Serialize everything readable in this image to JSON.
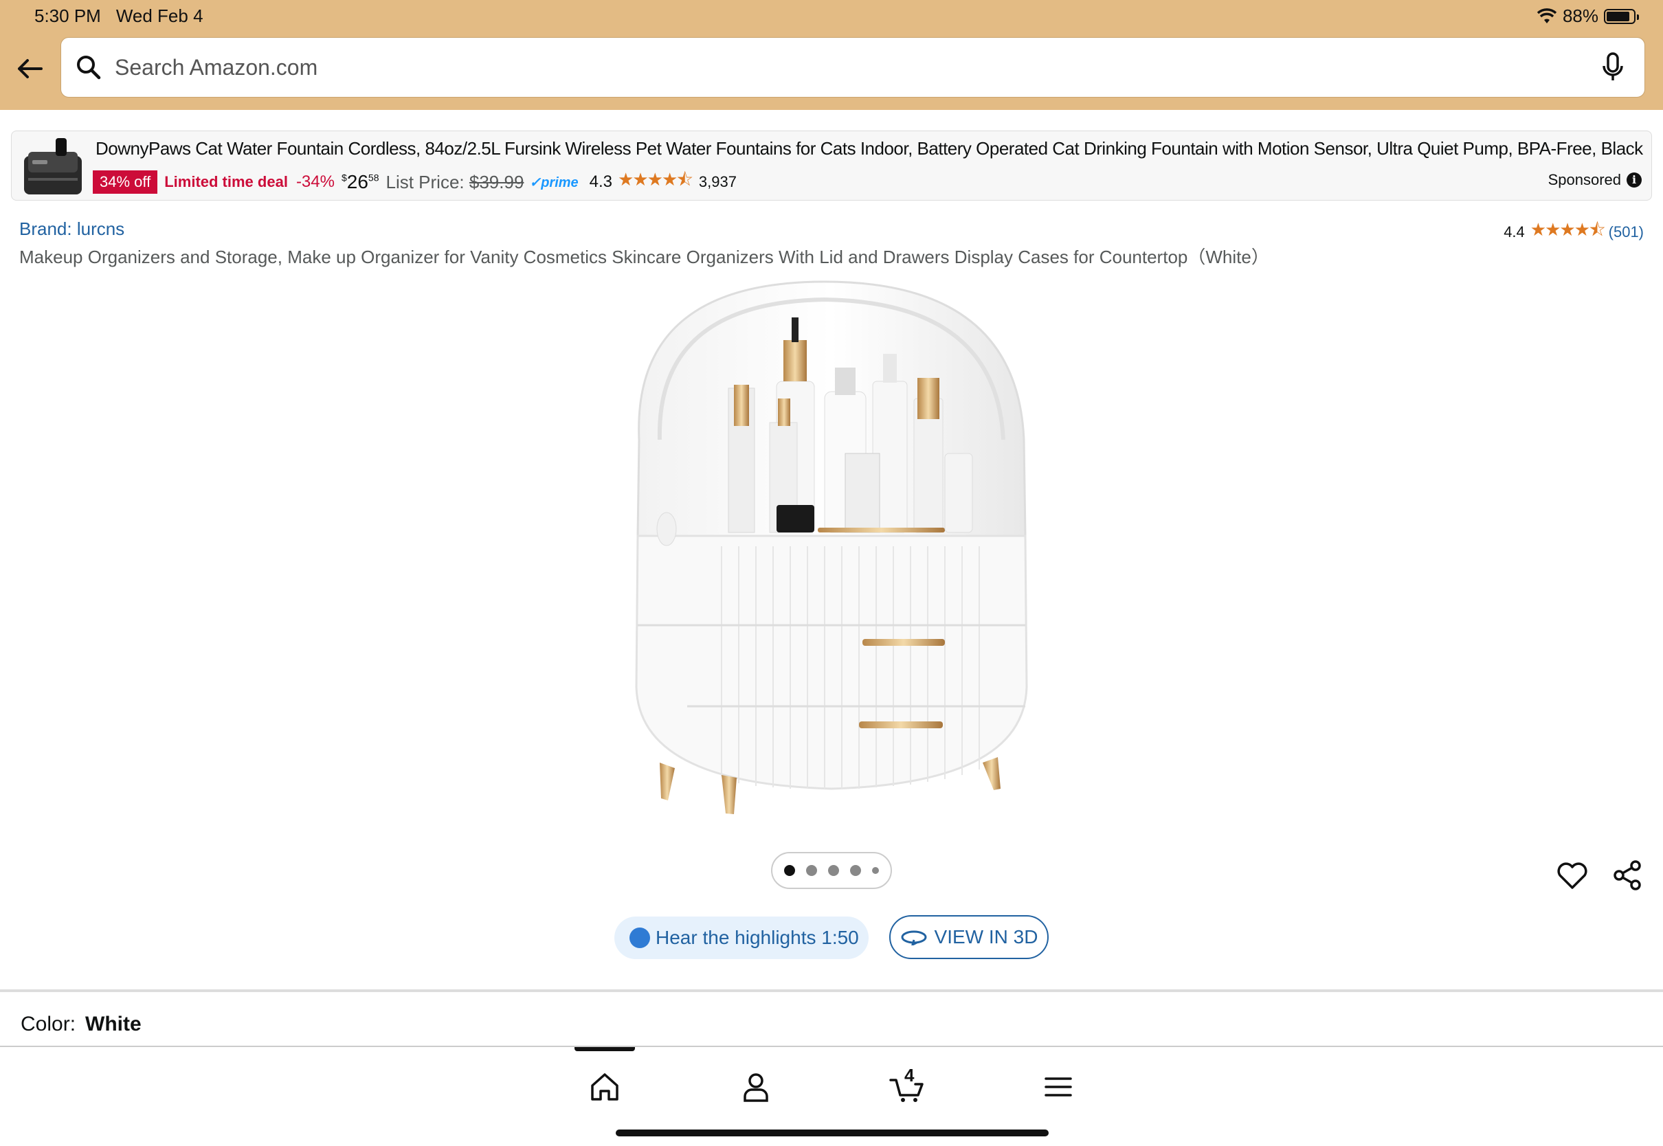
{
  "status": {
    "time": "5:30 PM",
    "date": "Wed Feb 4",
    "battery": "88%"
  },
  "search": {
    "placeholder": "Search Amazon.com"
  },
  "ad": {
    "title": "DownyPaws Cat Water Fountain Cordless, 84oz/2.5L Fursink Wireless Pet Water Fountains for Cats Indoor, Battery Operated Cat Drinking Fountain with Motion Sensor, Ultra Quiet Pump, BPA-Free, Black",
    "badge": "34% off",
    "deal": "Limited time deal",
    "discount": "-34%",
    "price_symbol": "$",
    "price_whole": "26",
    "price_fraction": "58",
    "list_label": "List Price:",
    "list_price": "$39.99",
    "prime": "prime",
    "rating": "4.3",
    "stars": "★★★★⯪",
    "review_count": "3,937",
    "sponsored": "Sponsored"
  },
  "product": {
    "brand": "Brand: lurcns",
    "rating": "4.4",
    "stars": "★★★★⯪",
    "review_count": "(501)",
    "title": "Makeup Organizers and Storage, Make up Organizer for Vanity Cosmetics Skincare Organizers With Lid and Drawers Display Cases for Countertop（White）",
    "image_count": 5,
    "hear_label": "Hear the highlights 1:50",
    "view3d_label": "VIEW IN 3D",
    "color_label": "Color:",
    "color_value": "White"
  },
  "bottom_nav": {
    "cart_count": "4"
  },
  "colors": {
    "header": "#e3bb84",
    "deal_red": "#cc0c39",
    "link_blue": "#2162a1",
    "star": "#de7921"
  }
}
